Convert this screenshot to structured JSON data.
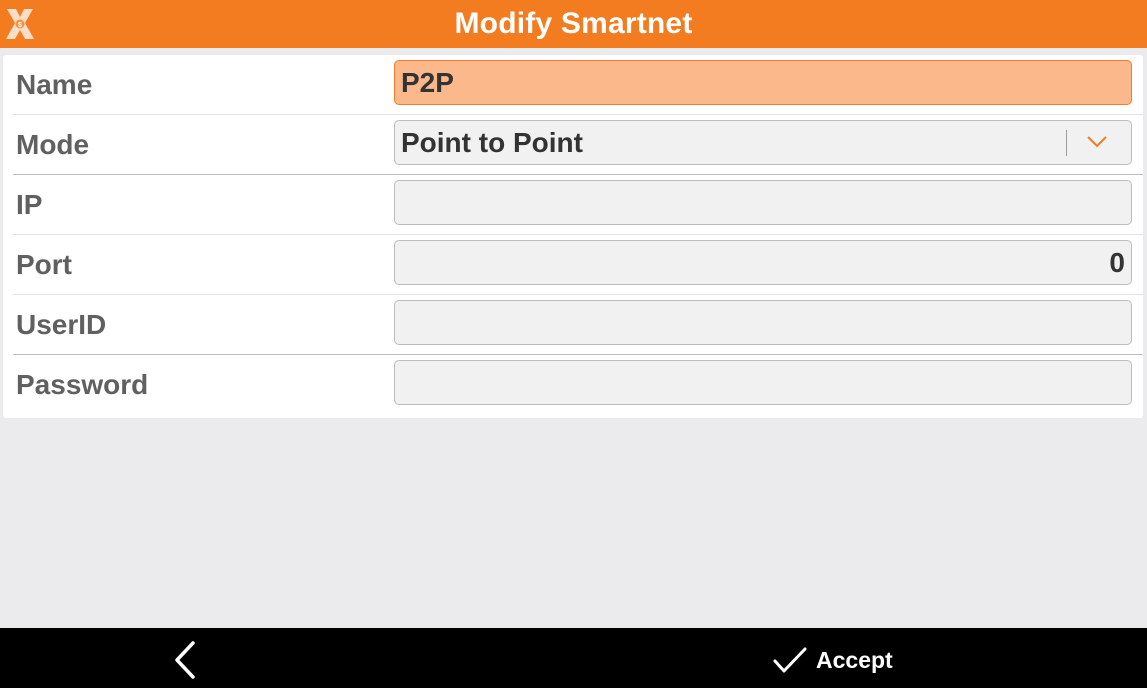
{
  "header": {
    "title": "Modify Smartnet",
    "logo_icon": "x-logo-icon",
    "accent_color": "#f47c20"
  },
  "form": {
    "rows": [
      {
        "label": "Name",
        "value": "P2P",
        "type": "text",
        "focused": true
      },
      {
        "label": "Mode",
        "value": "Point to Point",
        "type": "select"
      },
      {
        "label": "IP",
        "value": "",
        "type": "text"
      },
      {
        "label": "Port",
        "value": "0",
        "type": "number"
      },
      {
        "label": "UserID",
        "value": "",
        "type": "text"
      },
      {
        "label": "Password",
        "value": "",
        "type": "password"
      }
    ]
  },
  "footer": {
    "back_icon": "chevron-left-icon",
    "accept_icon": "check-icon",
    "accept_label": "Accept"
  }
}
